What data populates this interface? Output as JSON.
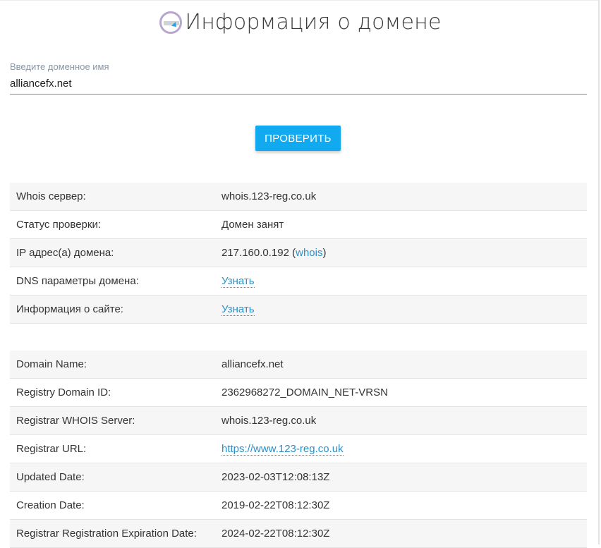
{
  "header": {
    "title": "Информация о домене",
    "logo_icon": "domain-info-icon"
  },
  "search": {
    "label": "Введите доменное имя",
    "value": "alliancefx.net"
  },
  "check_button": {
    "label": "ПРОВЕРИТЬ"
  },
  "summary": {
    "whois_server": {
      "label": "Whois сервер:",
      "value": "whois.123-reg.co.uk"
    },
    "status": {
      "label": "Статус проверки:",
      "value": "Домен занят"
    },
    "ip": {
      "label": "IP адрес(а) домена:",
      "value": "217.160.0.192",
      "open": "(",
      "link": "whois",
      "close": ")"
    },
    "dns": {
      "label": "DNS параметры домена:",
      "link": "Узнать"
    },
    "site_info": {
      "label": "Информация о сайте:",
      "link": "Узнать"
    }
  },
  "whois": {
    "domain_name": {
      "label": "Domain Name:",
      "value": "alliancefx.net"
    },
    "registry_domain_id": {
      "label": "Registry Domain ID:",
      "value": "2362968272_DOMAIN_NET-VRSN"
    },
    "registrar_whois_server": {
      "label": "Registrar WHOIS Server:",
      "value": "whois.123-reg.co.uk"
    },
    "registrar_url": {
      "label": "Registrar URL:",
      "link": "https://www.123-reg.co.uk"
    },
    "updated_date": {
      "label": "Updated Date:",
      "value": "2023-02-03T12:08:13Z"
    },
    "creation_date": {
      "label": "Creation Date:",
      "value": "2019-02-22T08:12:30Z"
    },
    "expiration_date": {
      "label": "Registrar Registration Expiration Date:",
      "value": "2024-02-22T08:12:30Z"
    }
  },
  "colors": {
    "accent": "#11a9ef",
    "link": "#2a90c8",
    "row_alt": "#f6f6f6"
  }
}
